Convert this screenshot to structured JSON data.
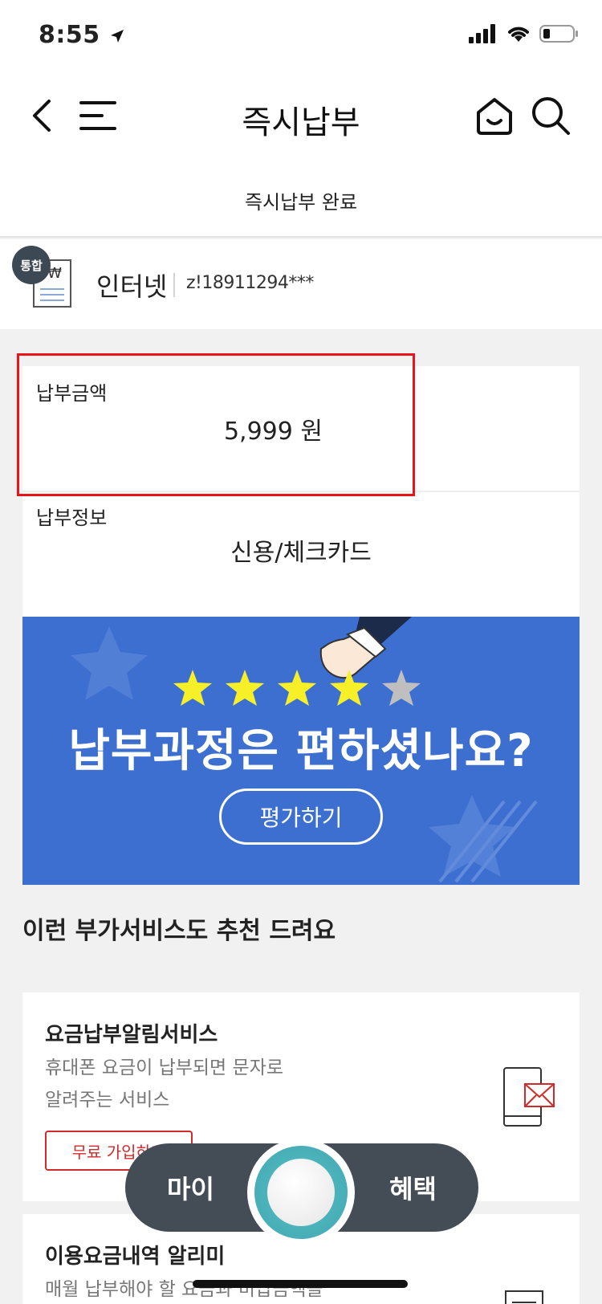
{
  "status_bar": {
    "time": "8:55"
  },
  "header": {
    "title": "즉시납부"
  },
  "sub_title": "즉시납부 완료",
  "service": {
    "badge": "통합",
    "name": "인터넷",
    "account": "z!18911294***"
  },
  "payment": {
    "amount_label": "납부금액",
    "amount_value": "5,999 원",
    "info_label": "납부정보",
    "info_value": "신용/체크카드"
  },
  "banner": {
    "headline": "납부과정은 편하셨나요?",
    "rate_button": "평가하기",
    "rating": {
      "filled": 4,
      "total": 5
    }
  },
  "recommend": {
    "title": "이런 부가서비스도 추천 드려요",
    "services": [
      {
        "name": "요금납부알림서비스",
        "desc_line1": "휴대폰 요금이 납부되면 문자로",
        "desc_line2": "알려주는 서비스",
        "button": "무료 가입하기"
      },
      {
        "name": "이용요금내역 알리미",
        "desc_line1": "매월 납부해야 할 요금과 미납금액을"
      }
    ]
  },
  "bottom_nav": {
    "left": "마이",
    "right": "혜택"
  },
  "colors": {
    "banner_bg": "#3d6fd1",
    "nav_bg": "#444d55",
    "accent_red": "#e8141a",
    "star_yellow": "#f7f028"
  }
}
